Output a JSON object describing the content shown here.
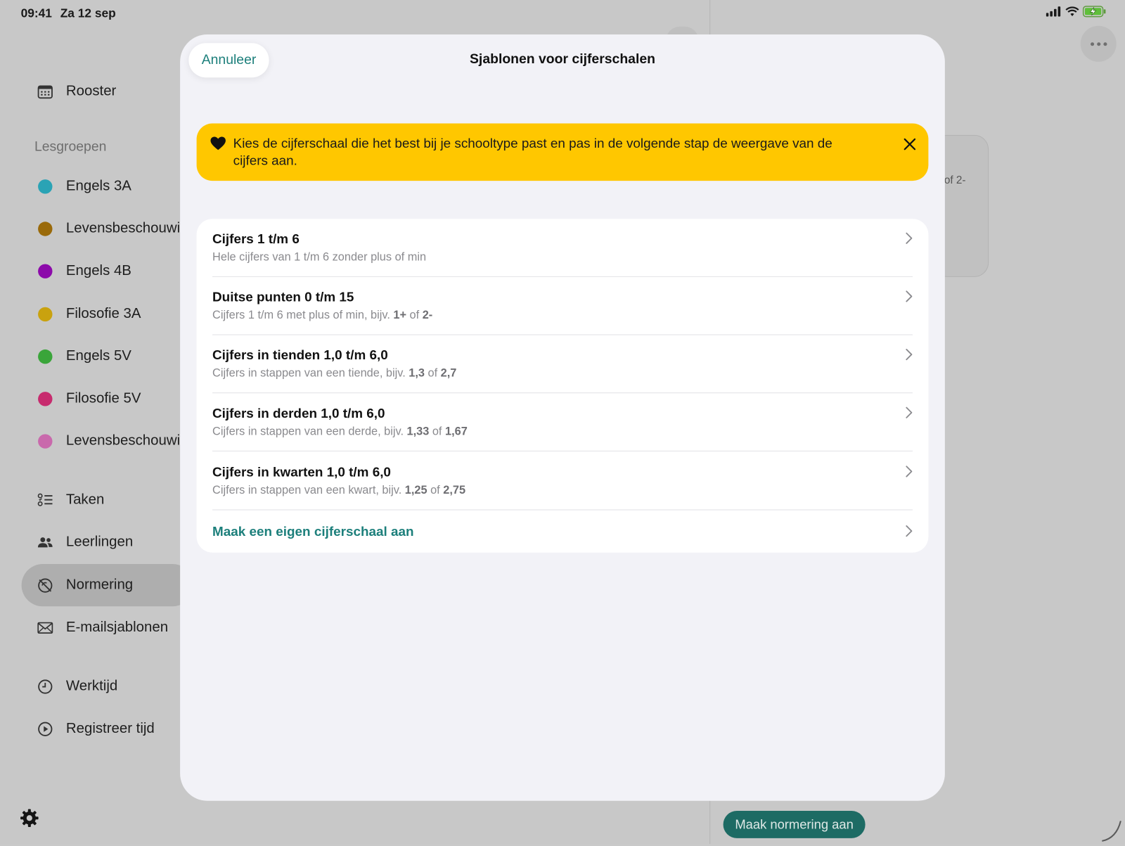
{
  "status_bar": {
    "time": "09:41",
    "date": "Za 12 sep"
  },
  "sidebar": {
    "rooster": "Rooster",
    "section_title": "Lesgroepen",
    "groups": [
      {
        "label": "Engels 3A",
        "color": "#2aa3b5"
      },
      {
        "label": "Levensbeschouwing",
        "color": "#9a6a0a"
      },
      {
        "label": "Engels 4B",
        "color": "#8c0aaa"
      },
      {
        "label": "Filosofie 3A",
        "color": "#c9a20f"
      },
      {
        "label": "Engels 5V",
        "color": "#3aa53a"
      },
      {
        "label": "Filosofie 5V",
        "color": "#c72b6e"
      },
      {
        "label": "Levensbeschouwing",
        "color": "#c969ac"
      }
    ],
    "nav": {
      "taken": "Taken",
      "leerlingen": "Leerlingen",
      "normering": "Normering",
      "emailsjablonen": "E-mailsjablonen",
      "werktijd": "Werktijd",
      "registreer": "Registreer tijd"
    },
    "active_item": "Normering"
  },
  "background": {
    "card_text": "of 2-",
    "primary_button": "Maak normering aan",
    "accent_color": "#1d6b64"
  },
  "modal": {
    "cancel_label": "Annuleer",
    "title": "Sjablonen voor cijferschalen",
    "banner": {
      "text": "Kies de cijferschaal die het best bij je schooltype past en pas in de volgende stap de weergave van de cijfers aan.",
      "color": "#ffc700"
    },
    "options": [
      {
        "title": "Cijfers 1 t/m 6",
        "sub_prefix": "Hele cijfers van 1 t/m 6 zonder plus of min",
        "ex1": "",
        "mid": "",
        "ex2": ""
      },
      {
        "title": "Duitse punten 0 t/m 15",
        "sub_prefix": "Cijfers 1 t/m 6 met plus of min, bijv. ",
        "ex1": "1+",
        "mid": " of ",
        "ex2": "2-"
      },
      {
        "title": "Cijfers in tienden 1,0 t/m 6,0",
        "sub_prefix": "Cijfers in stappen van een tiende, bijv. ",
        "ex1": "1,3",
        "mid": " of ",
        "ex2": "2,7"
      },
      {
        "title": "Cijfers in derden 1,0 t/m 6,0",
        "sub_prefix": "Cijfers in stappen van een derde, bijv. ",
        "ex1": "1,33",
        "mid": " of ",
        "ex2": "1,67"
      },
      {
        "title": "Cijfers in kwarten 1,0 t/m 6,0",
        "sub_prefix": "Cijfers in stappen van een kwart, bijv. ",
        "ex1": "1,25",
        "mid": " of ",
        "ex2": "2,75"
      }
    ],
    "custom_label": "Maak een eigen cijferschaal aan",
    "link_color": "#1c7f7b"
  }
}
